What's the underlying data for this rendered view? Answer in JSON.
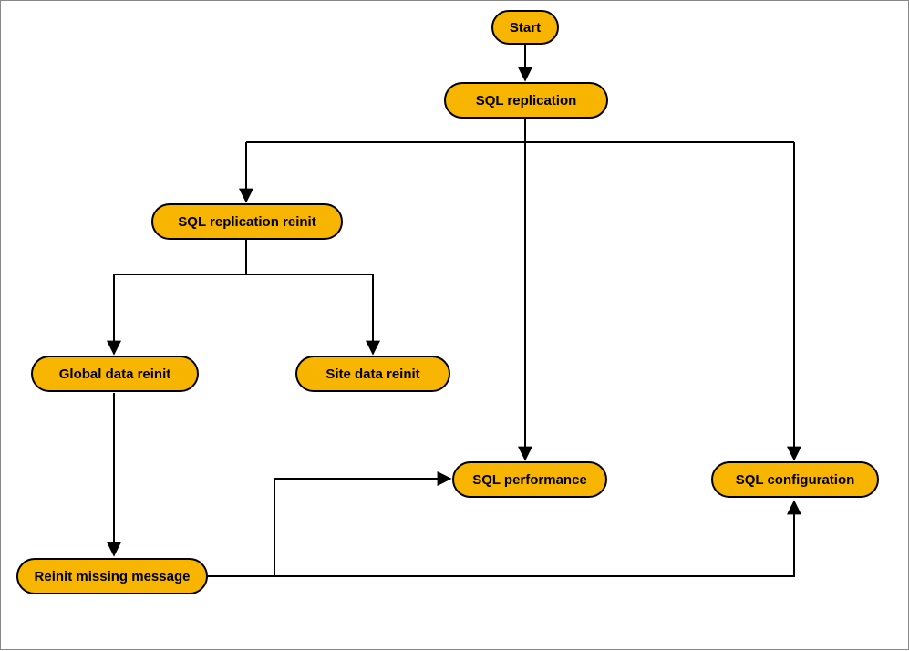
{
  "diagram": {
    "nodes": {
      "start": "Start",
      "sql_replication": "SQL replication",
      "sql_replication_reinit": "SQL replication reinit",
      "global_data_reinit": "Global data reinit",
      "site_data_reinit": "Site data reinit",
      "sql_performance": "SQL performance",
      "sql_configuration": "SQL configuration",
      "reinit_missing_message": "Reinit missing message"
    },
    "edges": [
      {
        "from": "start",
        "to": "sql_replication"
      },
      {
        "from": "sql_replication",
        "to": "sql_replication_reinit"
      },
      {
        "from": "sql_replication",
        "to": "sql_performance"
      },
      {
        "from": "sql_replication",
        "to": "sql_configuration"
      },
      {
        "from": "sql_replication_reinit",
        "to": "global_data_reinit"
      },
      {
        "from": "sql_replication_reinit",
        "to": "site_data_reinit"
      },
      {
        "from": "global_data_reinit",
        "to": "reinit_missing_message"
      },
      {
        "from": "reinit_missing_message",
        "to": "sql_performance"
      },
      {
        "from": "reinit_missing_message",
        "to": "sql_configuration"
      }
    ],
    "colors": {
      "node_fill": "#f7b500",
      "node_border": "#000000",
      "edge": "#000000"
    }
  }
}
